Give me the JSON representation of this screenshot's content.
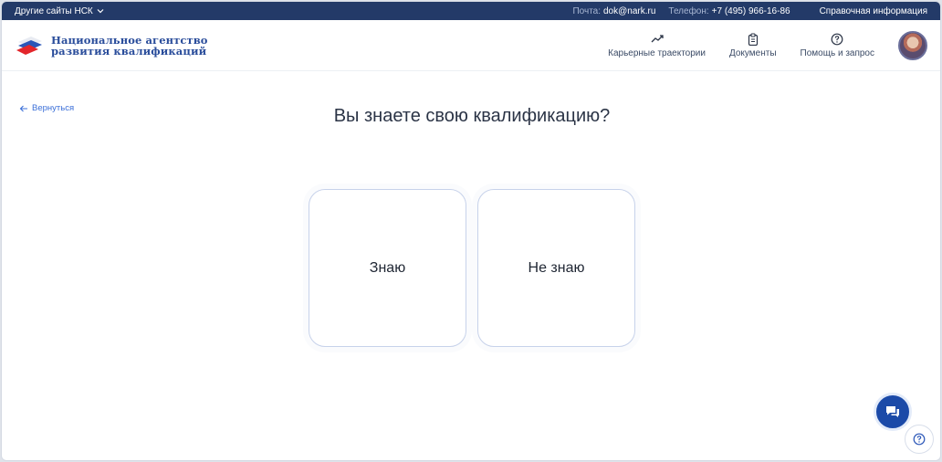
{
  "topbar": {
    "other_sites": "Другие сайты НСК",
    "email_label": "Почта:",
    "email_value": "dok@nark.ru",
    "phone_label": "Телефон:",
    "phone_value": "+7 (495) 966-16-86",
    "reference": "Справочная информация"
  },
  "header": {
    "logo_line1": "Национальное агентство",
    "logo_line2": "развития квалификаций",
    "nav": {
      "career": "Карьерные траектории",
      "documents": "Документы",
      "help": "Помощь и запрос"
    }
  },
  "main": {
    "back": "Вернуться",
    "title": "Вы знаете свою квалификацию?",
    "options": {
      "know": "Знаю",
      "dont_know": "Не знаю"
    }
  },
  "colors": {
    "topbar_bg": "#233a68",
    "accent": "#2a4d9b",
    "chat_button": "#1b4aa8"
  }
}
